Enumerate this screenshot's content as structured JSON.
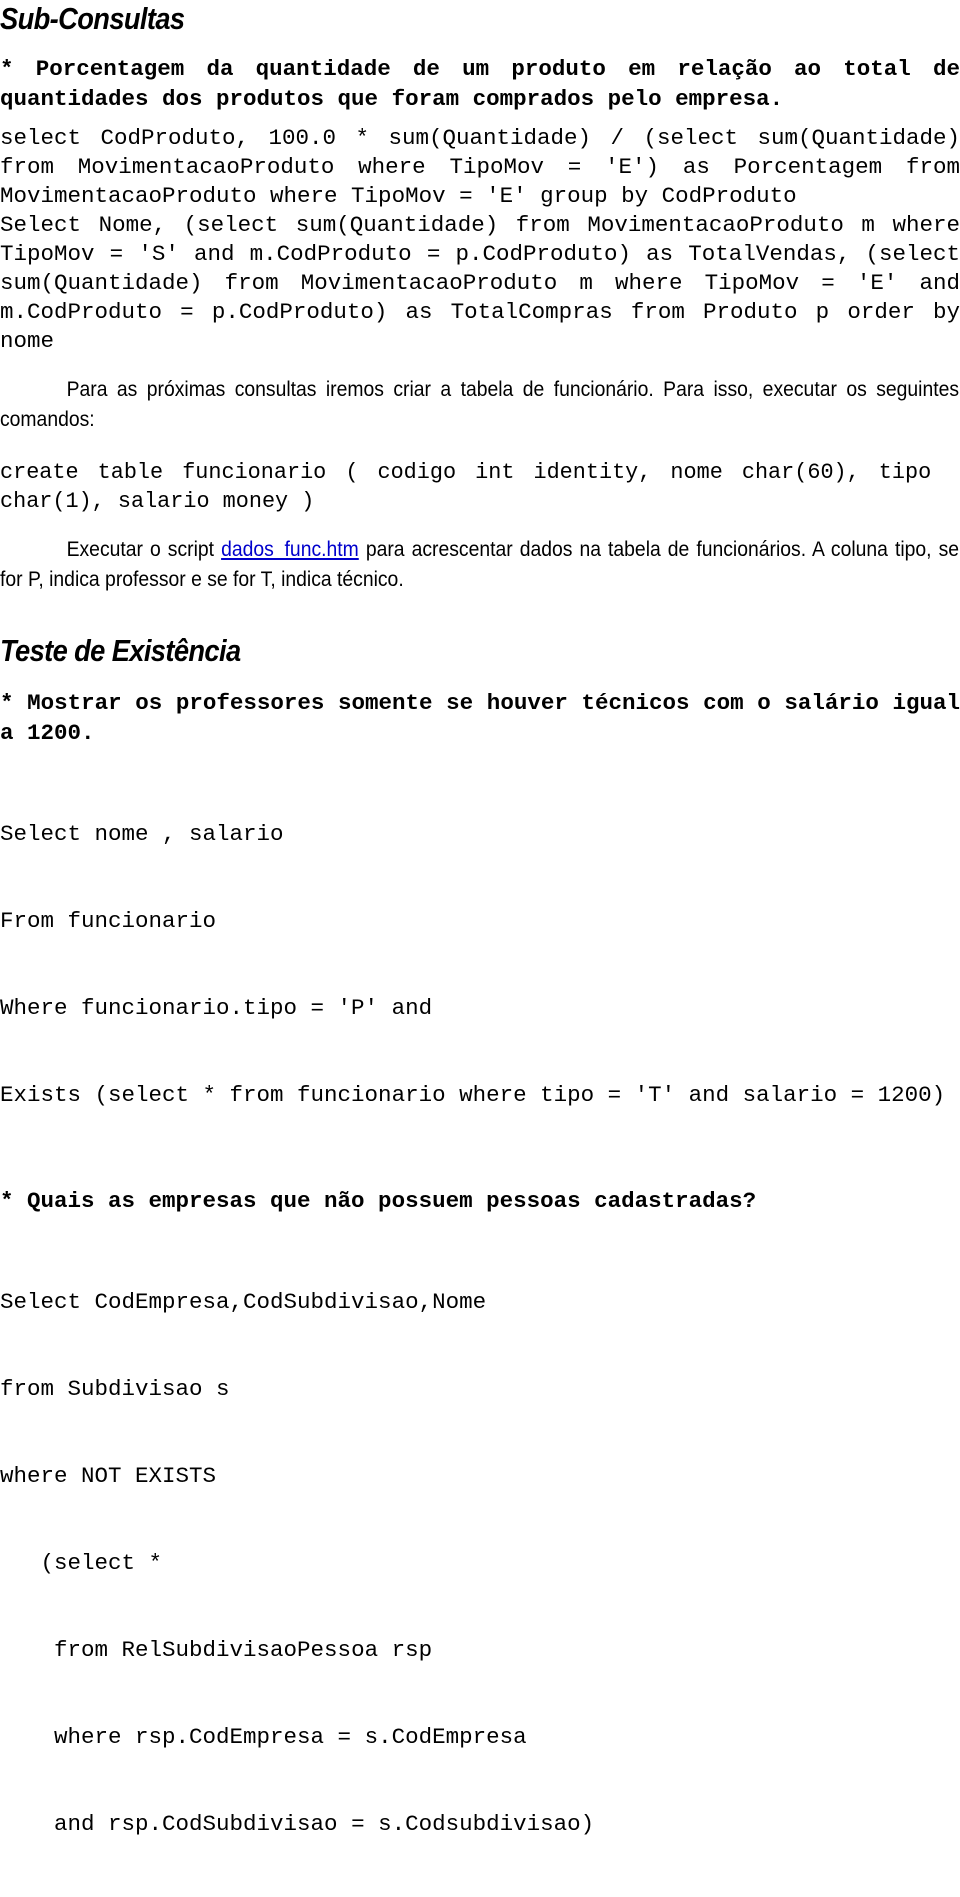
{
  "document": {
    "sections": [
      {
        "heading": "Sub-Consultas",
        "question1": "* Porcentagem da quantidade de um produto em relação ao total de quantidades dos produtos que foram comprados pelo empresa.",
        "code1": "select CodProduto, 100.0 * sum(Quantidade) / (select sum(Quantidade) from MovimentacaoProduto where TipoMov = 'E') as Porcentagem from MovimentacaoProduto where TipoMov = 'E' group by CodProduto",
        "code2": "Select Nome, (select sum(Quantidade) from MovimentacaoProduto m where TipoMov = 'S' and m.CodProduto = p.CodProduto) as TotalVendas, (select sum(Quantidade) from MovimentacaoProduto m where TipoMov = 'E' and m.CodProduto = p.CodProduto) as TotalCompras from Produto p order by nome",
        "prose1": "Para as próximas consultas iremos criar a tabela de funcionário. Para isso, executar os seguintes comandos:",
        "code3": "create table funcionario ( codigo int identity, nome char(60), tipo char(1), salario money )",
        "prose2_before_link": "Executar o script ",
        "prose2_link": "dados_func.htm",
        "prose2_after_link": " para acrescentar dados na tabela de funcionários. A coluna tipo, se for P, indica professor e se for T, indica técnico."
      },
      {
        "heading": "Teste de Existência",
        "question1": "* Mostrar os professores somente se houver técnicos com o salário igual a 1200.",
        "code1_lines": [
          "Select nome , salario",
          "From funcionario",
          "Where funcionario.tipo = 'P' and",
          "Exists (select * from funcionario where tipo = 'T' and salario = 1200)"
        ],
        "question2": "* Quais as empresas que não possuem pessoas cadastradas?",
        "code2_lines": [
          "Select CodEmpresa,CodSubdivisao,Nome",
          "from Subdivisao s",
          "where NOT EXISTS",
          "   (select *",
          "    from RelSubdivisaoPessoa rsp",
          "    where rsp.CodEmpresa = s.CodEmpresa",
          "    and rsp.CodSubdivisao = s.Codsubdivisao)"
        ]
      }
    ]
  },
  "colors": {
    "text": "#000000",
    "link": "#0000CC",
    "background": "#FFFFFF"
  }
}
